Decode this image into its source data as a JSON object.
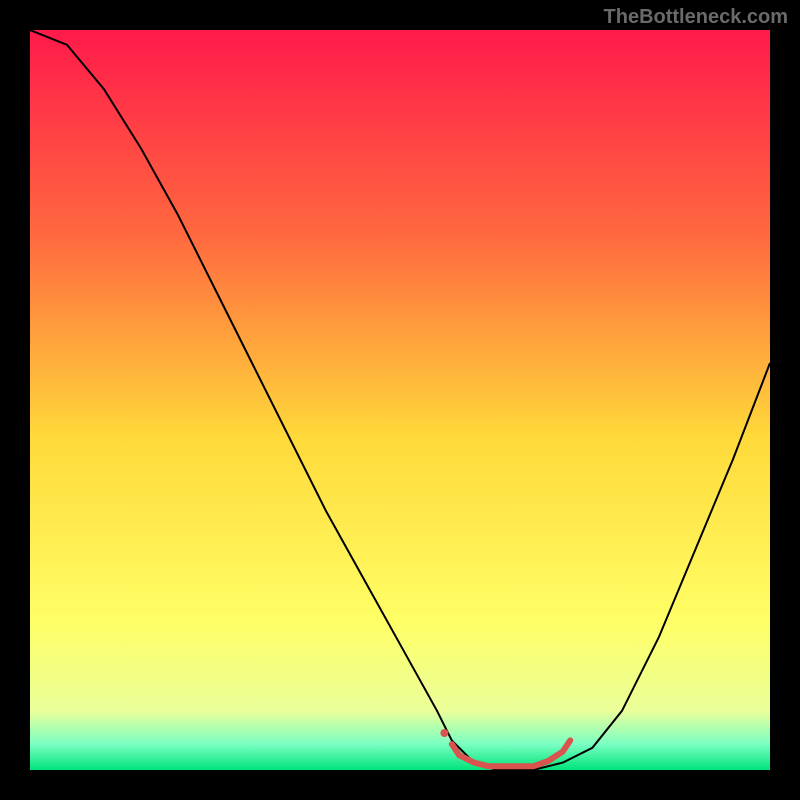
{
  "watermark": "TheBottleneck.com",
  "chart_data": {
    "type": "line",
    "title": "",
    "xlabel": "",
    "ylabel": "",
    "xlim": [
      0,
      100
    ],
    "ylim": [
      0,
      100
    ],
    "gradient_stops": [
      {
        "offset": 0,
        "color": "#ff1a4a"
      },
      {
        "offset": 0.28,
        "color": "#ff6a3f"
      },
      {
        "offset": 0.55,
        "color": "#ffd93a"
      },
      {
        "offset": 0.8,
        "color": "#ffff66"
      },
      {
        "offset": 0.92,
        "color": "#eaff9a"
      },
      {
        "offset": 0.965,
        "color": "#7affc2"
      },
      {
        "offset": 1.0,
        "color": "#00e47a"
      }
    ],
    "series": [
      {
        "name": "bottleneck-curve",
        "color": "#000000",
        "width": 2,
        "x": [
          0,
          5,
          10,
          15,
          20,
          25,
          30,
          35,
          40,
          45,
          50,
          55,
          57,
          60,
          63,
          68,
          72,
          76,
          80,
          85,
          90,
          95,
          100
        ],
        "y": [
          100,
          98,
          92,
          84,
          75,
          65,
          55,
          45,
          35,
          26,
          17,
          8,
          4,
          1,
          0,
          0,
          1,
          3,
          8,
          18,
          30,
          42,
          55
        ]
      },
      {
        "name": "optimal-range-marker",
        "color": "#d9534f",
        "width": 6,
        "x": [
          57,
          58,
          60,
          62,
          65,
          68,
          70,
          72,
          73
        ],
        "y": [
          3.5,
          2,
          1,
          0.5,
          0.5,
          0.5,
          1.2,
          2.5,
          4
        ]
      }
    ],
    "marker": {
      "name": "optimal-start-dot",
      "x": 56,
      "y": 5,
      "r": 4,
      "color": "#d9534f"
    }
  }
}
